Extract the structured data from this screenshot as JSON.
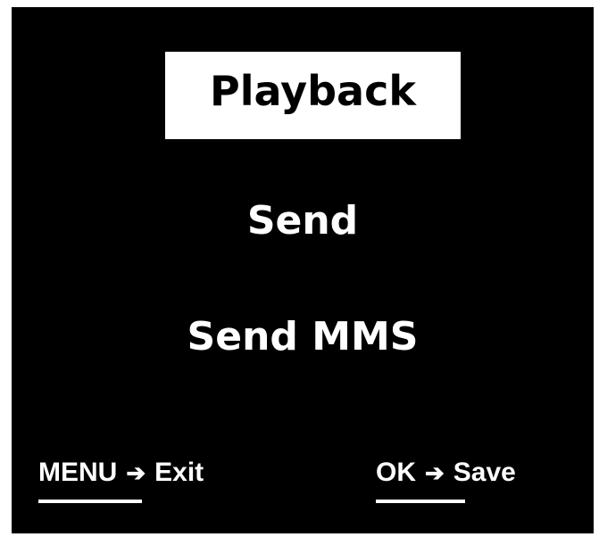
{
  "screen": {
    "background": "#000000",
    "foreground": "#ffffff"
  },
  "menu": {
    "items": [
      {
        "label": "Playback",
        "selected": true
      },
      {
        "label": "Send",
        "selected": false
      },
      {
        "label": "Send MMS",
        "selected": false
      }
    ]
  },
  "footer": {
    "menu_key": "MENU",
    "menu_action": "Exit",
    "ok_key": "OK",
    "ok_action": "Save",
    "arrow_icon": "right-arrow-icon"
  }
}
